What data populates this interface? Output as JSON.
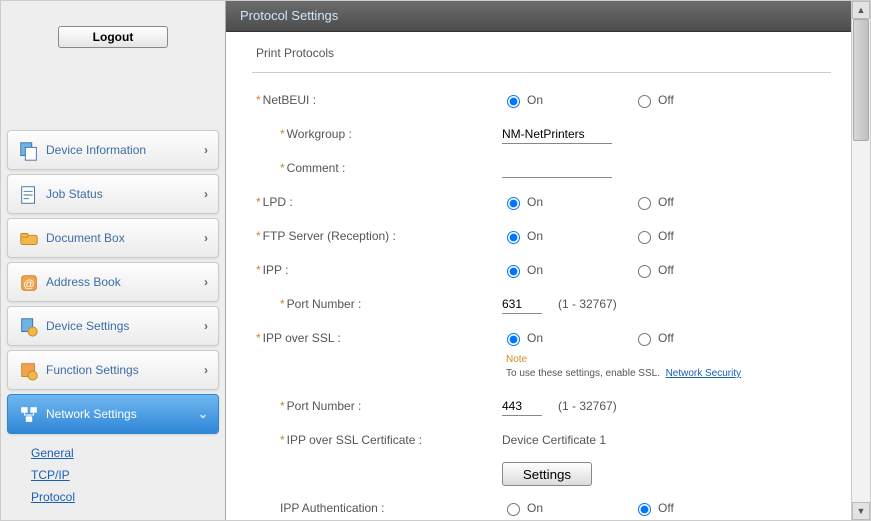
{
  "logout_label": "Logout",
  "sidebar": {
    "items": [
      {
        "label": "Device Information"
      },
      {
        "label": "Job Status"
      },
      {
        "label": "Document Box"
      },
      {
        "label": "Address Book"
      },
      {
        "label": "Device Settings"
      },
      {
        "label": "Function Settings"
      },
      {
        "label": "Network Settings"
      }
    ],
    "sub": [
      {
        "label": "General"
      },
      {
        "label": "TCP/IP"
      },
      {
        "label": "Protocol"
      }
    ]
  },
  "header": {
    "title": "Protocol Settings"
  },
  "section": {
    "title": "Print Protocols"
  },
  "labels": {
    "netbeui": "NetBEUI :",
    "workgroup": "Workgroup :",
    "comment": "Comment :",
    "lpd": "LPD :",
    "ftp": "FTP Server (Reception) :",
    "ipp": "IPP :",
    "port": "Port Number :",
    "ipp_ssl": "IPP over SSL :",
    "ipp_ssl_cert": "IPP over SSL Certificate :",
    "ipp_auth": "IPP Authentication :",
    "on": "On",
    "off": "Off",
    "range": "(1 - 32767)",
    "settings": "Settings"
  },
  "values": {
    "workgroup": "NM-NetPrinters",
    "comment": "",
    "ipp_port": "631",
    "ipp_ssl_port": "443",
    "cert": "Device Certificate 1"
  },
  "note": {
    "title": "Note",
    "text": "To use these settings, enable SSL.",
    "link": "Network Security"
  }
}
